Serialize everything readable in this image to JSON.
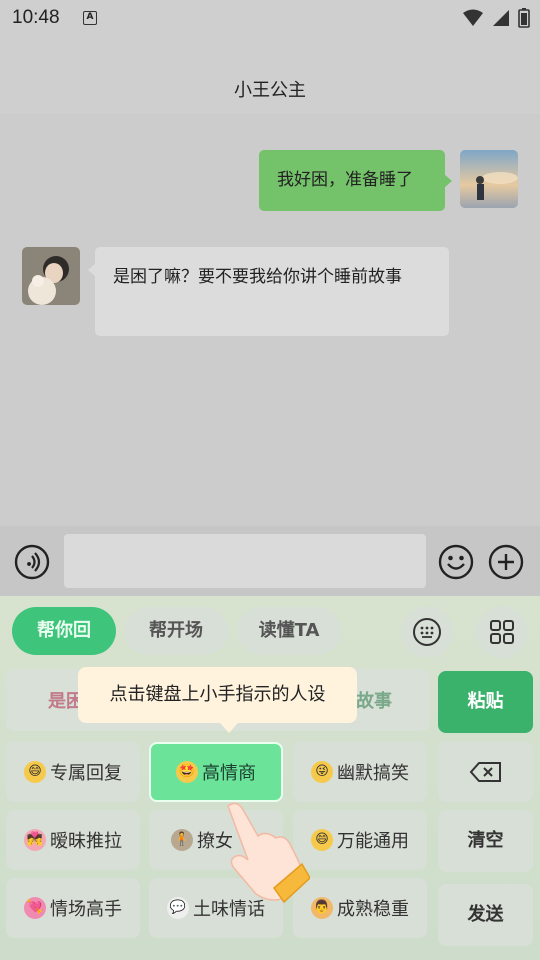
{
  "status_bar": {
    "time": "10:48",
    "badge": "A"
  },
  "chat": {
    "title": "小王公主",
    "messages": [
      {
        "from": "me",
        "text": "我好困，准备睡了"
      },
      {
        "from": "them",
        "text": "是困了嘛？要不要我给你讲个睡前故事"
      }
    ]
  },
  "keyboard": {
    "tabs": [
      {
        "label": "帮你回",
        "active": true
      },
      {
        "label": "帮开场",
        "active": false
      },
      {
        "label": "读懂TA",
        "active": false
      }
    ],
    "suggestion": {
      "left_text": "是困",
      "right_text": "故事"
    },
    "tooltip": "点击键盘上小手指示的人设",
    "paste_label": "粘贴",
    "clear_label": "清空",
    "send_label": "发送",
    "personas": [
      {
        "label": "专属回复",
        "icon": "grin-emoji-icon"
      },
      {
        "label": "高情商",
        "icon": "star-eyes-emoji-icon"
      },
      {
        "label": "幽默搞笑",
        "icon": "tongue-emoji-icon"
      },
      {
        "label": "暧昧推拉",
        "icon": "couple-kiss-icon"
      },
      {
        "label": "撩女",
        "icon": "person-icon"
      },
      {
        "label": "万能通用",
        "icon": "grin-emoji-icon"
      },
      {
        "label": "情场高手",
        "icon": "heart-arrow-icon"
      },
      {
        "label": "土味情话",
        "icon": "speech-bubble-icon"
      },
      {
        "label": "成熟稳重",
        "icon": "man-face-icon"
      }
    ]
  },
  "colors": {
    "accent": "#3ec47b",
    "bubble_me": "#74c26a",
    "tooltip_bg": "#fff3de"
  }
}
